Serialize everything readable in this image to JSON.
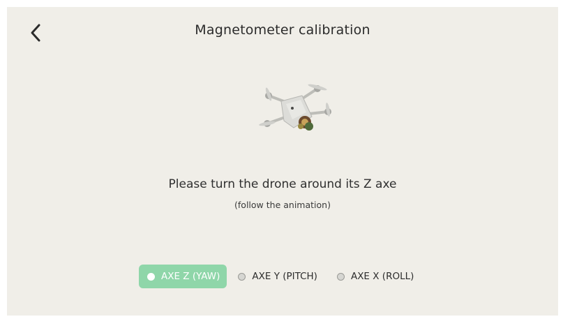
{
  "header": {
    "title": "Magnetometer calibration",
    "back_icon": "chevron-left-icon"
  },
  "main": {
    "illustration": "drone-illustration",
    "instruction": "Please turn the drone around its Z axe",
    "sub_instruction": "(follow the animation)"
  },
  "axes": {
    "options": [
      {
        "label": "AXE Z (YAW)",
        "selected": true
      },
      {
        "label": "AXE Y (PITCH)",
        "selected": false
      },
      {
        "label": "AXE X (ROLL)",
        "selected": false
      }
    ]
  },
  "colors": {
    "background": "#f0eee8",
    "accent": "#8fd6a9",
    "text": "#2b2b2b"
  }
}
